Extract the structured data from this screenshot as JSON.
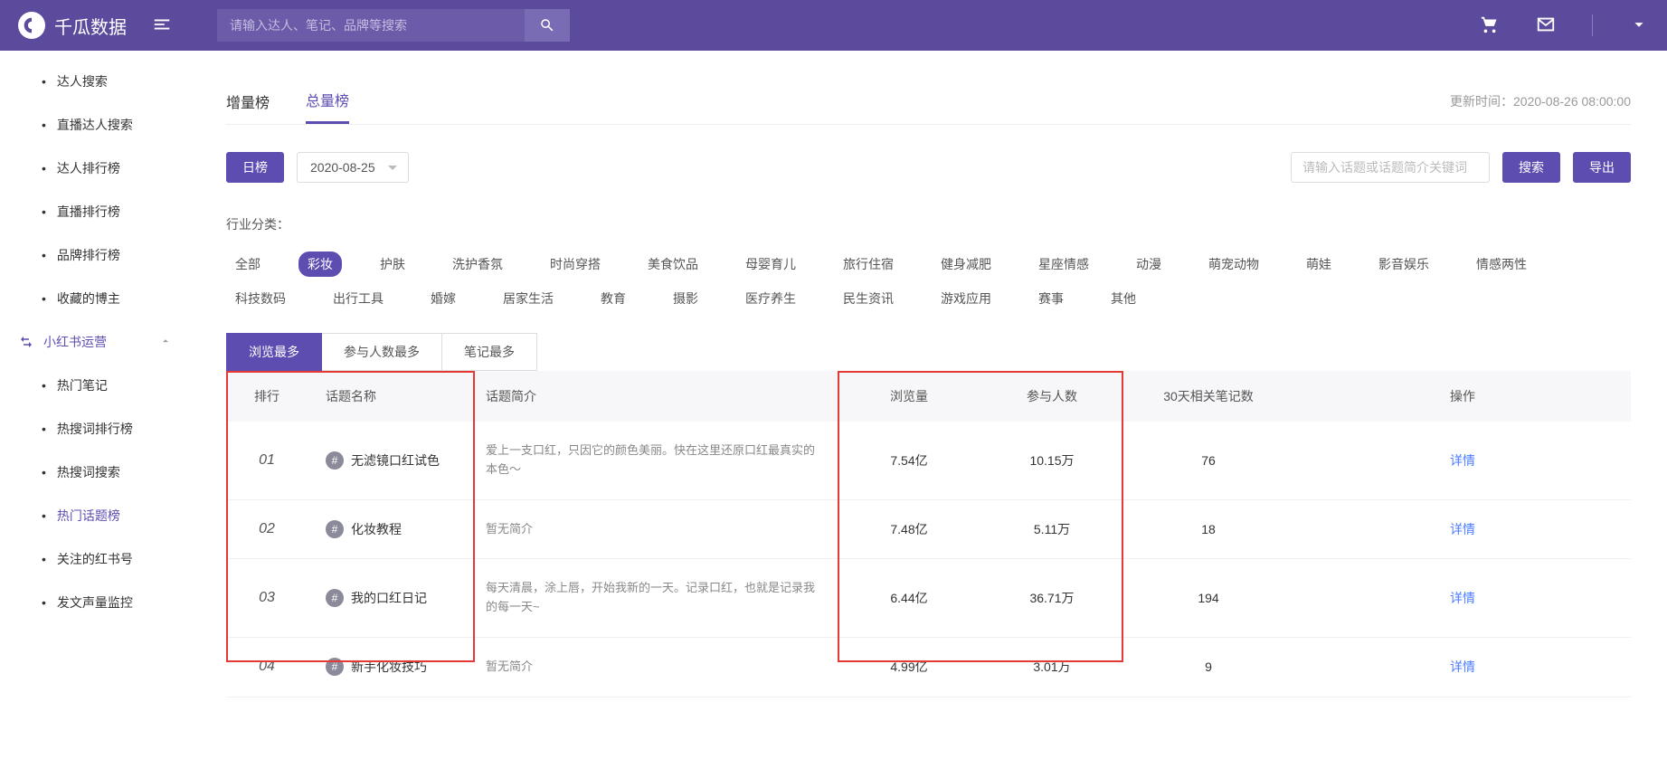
{
  "header": {
    "brand": "千瓜数据",
    "search_placeholder": "请输入达人、笔记、品牌等搜索"
  },
  "sidebar": {
    "items_top": [
      {
        "label": "达人搜索"
      },
      {
        "label": "直播达人搜索"
      },
      {
        "label": "达人排行榜"
      },
      {
        "label": "直播排行榜"
      },
      {
        "label": "品牌排行榜"
      },
      {
        "label": "收藏的博主"
      }
    ],
    "group": {
      "label": "小红书运营"
    },
    "items_bottom": [
      {
        "label": "热门笔记"
      },
      {
        "label": "热搜词排行榜"
      },
      {
        "label": "热搜词搜索"
      },
      {
        "label": "热门话题榜",
        "active": true
      },
      {
        "label": "关注的红书号"
      },
      {
        "label": "发文声量监控"
      }
    ]
  },
  "tabs": {
    "items": [
      {
        "label": "增量榜"
      },
      {
        "label": "总量榜",
        "active": true
      }
    ],
    "update_label": "更新时间：",
    "update_time": "2020-08-26 08:00:00"
  },
  "filters": {
    "day_label": "日榜",
    "date": "2020-08-25",
    "topic_search_placeholder": "请输入话题或话题简介关键词",
    "search_label": "搜索",
    "export_label": "导出"
  },
  "categories": {
    "label": "行业分类：",
    "row1": [
      "全部",
      "彩妆",
      "护肤",
      "洗护香氛",
      "时尚穿搭",
      "美食饮品",
      "母婴育儿",
      "旅行住宿",
      "健身减肥",
      "星座情感",
      "动漫",
      "萌宠动物",
      "萌娃",
      "影音娱乐",
      "情感两性"
    ],
    "row2": [
      "科技数码",
      "出行工具",
      "婚嫁",
      "居家生活",
      "教育",
      "摄影",
      "医疗养生",
      "民生资讯",
      "游戏应用",
      "赛事",
      "其他"
    ],
    "active": "彩妆"
  },
  "sort_tabs": [
    "浏览最多",
    "参与人数最多",
    "笔记最多"
  ],
  "sort_active": "浏览最多",
  "table": {
    "headers": [
      "排行",
      "话题名称",
      "话题简介",
      "浏览量",
      "参与人数",
      "30天相关笔记数",
      "操作"
    ],
    "detail_label": "详情",
    "rows": [
      {
        "rank": "01",
        "name": "无滤镜口红试色",
        "desc": "爱上一支口红，只因它的颜色美丽。快在这里还原口红最真实的本色～",
        "views": "7.54亿",
        "participants": "10.15万",
        "notes": "76"
      },
      {
        "rank": "02",
        "name": "化妆教程",
        "desc": "暂无简介",
        "views": "7.48亿",
        "participants": "5.11万",
        "notes": "18"
      },
      {
        "rank": "03",
        "name": "我的口红日记",
        "desc": "每天清晨，涂上唇，开始我新的一天。记录口红，也就是记录我的每一天~",
        "views": "6.44亿",
        "participants": "36.71万",
        "notes": "194"
      },
      {
        "rank": "04",
        "name": "新手化妆技巧",
        "desc": "暂无简介",
        "views": "4.99亿",
        "participants": "3.01万",
        "notes": "9"
      }
    ]
  }
}
